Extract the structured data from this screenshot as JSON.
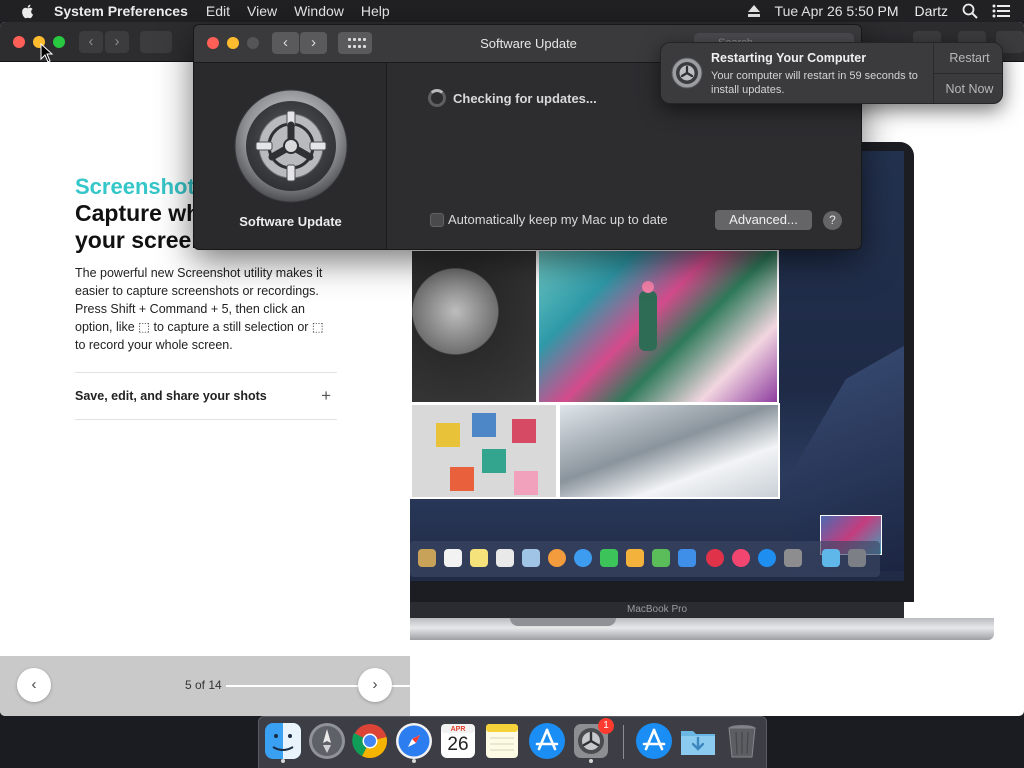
{
  "menubar": {
    "app_name": "System Preferences",
    "menus": [
      "Edit",
      "View",
      "Window",
      "Help"
    ],
    "clock": "Tue Apr 26  5:50 PM",
    "user": "Dartz"
  },
  "background_page": {
    "eyebrow": "Screenshot",
    "headline": "Capture what's on your screen",
    "body": "The powerful new Screenshot utility makes it easier to capture screenshots or recordings. Press Shift + Command + 5, then click an option, like ⬚ to capture a still selection or ⬚ to record your whole screen.",
    "accordion_label": "Save, edit, and share your shots",
    "accordion_toggle": "+",
    "pager": {
      "prev": "‹",
      "next": "›",
      "count": "5 of 14"
    },
    "laptop_label": "MacBook Pro"
  },
  "software_update": {
    "window_title": "Software Update",
    "pane_title": "Software Update",
    "status": "Checking for updates...",
    "auto_update_label": "Automatically keep my Mac up to date",
    "auto_update_checked": false,
    "advanced_button": "Advanced...",
    "help_button": "?",
    "search_placeholder": "Search"
  },
  "notification": {
    "title": "Restarting Your Computer",
    "body": "Your computer will restart in 59 seconds to install updates.",
    "primary_action": "Restart",
    "secondary_action": "Not Now"
  },
  "dock": {
    "items": [
      {
        "name": "Finder",
        "icon": "finder-icon",
        "running": true
      },
      {
        "name": "Launchpad",
        "icon": "launchpad-icon",
        "running": false
      },
      {
        "name": "Google Chrome",
        "icon": "chrome-icon",
        "running": false
      },
      {
        "name": "Safari",
        "icon": "safari-icon",
        "running": true
      },
      {
        "name": "Calendar",
        "icon": "calendar-icon",
        "running": false,
        "month": "APR",
        "day": "26"
      },
      {
        "name": "Notes",
        "icon": "notes-icon",
        "running": false
      },
      {
        "name": "App Store",
        "icon": "app-store-icon",
        "running": false
      },
      {
        "name": "System Preferences",
        "icon": "system-preferences-icon",
        "running": true,
        "badge": "1"
      },
      {
        "name": "App Store (downloads)",
        "icon": "app-store-icon",
        "running": false
      },
      {
        "name": "Downloads",
        "icon": "downloads-folder-icon",
        "running": false
      },
      {
        "name": "Trash",
        "icon": "trash-icon",
        "running": false
      }
    ]
  },
  "colors": {
    "accent_teal": "#35c6c9",
    "menubar_bg": "#212124",
    "window_bg": "#2d2d30",
    "close": "#ff5f57",
    "minimize": "#febc2e",
    "zoom": "#28c840"
  }
}
